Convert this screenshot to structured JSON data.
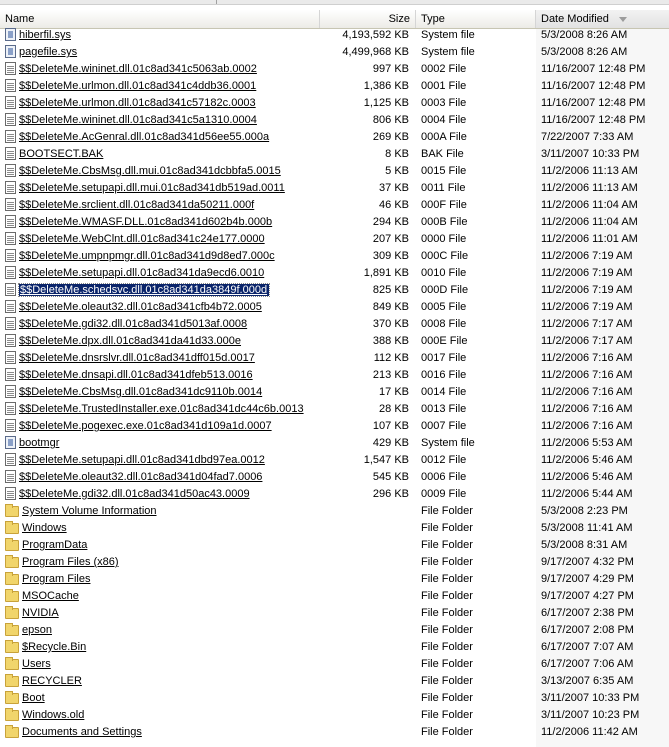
{
  "columns": {
    "name": "Name",
    "size": "Size",
    "type": "Type",
    "date": "Date Modified"
  },
  "selected_row": 15,
  "rows": [
    {
      "name": "hiberfil.sys",
      "size": "4,193,592 KB",
      "type": "System file",
      "date": "5/3/2008 8:26 AM",
      "icon": "sys-file-icon"
    },
    {
      "name": "pagefile.sys",
      "size": "4,499,968 KB",
      "type": "System file",
      "date": "5/3/2008 8:26 AM",
      "icon": "sys-file-icon"
    },
    {
      "name": "$$DeleteMe.wininet.dll.01c8ad341c5063ab.0002",
      "size": "997 KB",
      "type": "0002 File",
      "date": "11/16/2007 12:48 PM",
      "icon": "file-icon"
    },
    {
      "name": "$$DeleteMe.urlmon.dll.01c8ad341c4ddb36.0001",
      "size": "1,386 KB",
      "type": "0001 File",
      "date": "11/16/2007 12:48 PM",
      "icon": "file-icon"
    },
    {
      "name": "$$DeleteMe.urlmon.dll.01c8ad341c57182c.0003",
      "size": "1,125 KB",
      "type": "0003 File",
      "date": "11/16/2007 12:48 PM",
      "icon": "file-icon"
    },
    {
      "name": "$$DeleteMe.wininet.dll.01c8ad341c5a1310.0004",
      "size": "806 KB",
      "type": "0004 File",
      "date": "11/16/2007 12:48 PM",
      "icon": "file-icon"
    },
    {
      "name": "$$DeleteMe.AcGenral.dll.01c8ad341d56ee55.000a",
      "size": "269 KB",
      "type": "000A File",
      "date": "7/22/2007 7:33 AM",
      "icon": "file-icon"
    },
    {
      "name": "BOOTSECT.BAK",
      "size": "8 KB",
      "type": "BAK File",
      "date": "3/11/2007 10:33 PM",
      "icon": "file-icon"
    },
    {
      "name": "$$DeleteMe.CbsMsg.dll.mui.01c8ad341dcbbfa5.0015",
      "size": "5 KB",
      "type": "0015 File",
      "date": "11/2/2006 11:13 AM",
      "icon": "file-icon"
    },
    {
      "name": "$$DeleteMe.setupapi.dll.mui.01c8ad341db519ad.0011",
      "size": "37 KB",
      "type": "0011 File",
      "date": "11/2/2006 11:13 AM",
      "icon": "file-icon"
    },
    {
      "name": "$$DeleteMe.srclient.dll.01c8ad341da50211.000f",
      "size": "46 KB",
      "type": "000F File",
      "date": "11/2/2006 11:04 AM",
      "icon": "file-icon"
    },
    {
      "name": "$$DeleteMe.WMASF.DLL.01c8ad341d602b4b.000b",
      "size": "294 KB",
      "type": "000B File",
      "date": "11/2/2006 11:04 AM",
      "icon": "file-icon"
    },
    {
      "name": "$$DeleteMe.WebClnt.dll.01c8ad341c24e177.0000",
      "size": "207 KB",
      "type": "0000 File",
      "date": "11/2/2006 11:01 AM",
      "icon": "file-icon"
    },
    {
      "name": "$$DeleteMe.umpnpmgr.dll.01c8ad341d9d8ed7.000c",
      "size": "309 KB",
      "type": "000C File",
      "date": "11/2/2006 7:19 AM",
      "icon": "file-icon"
    },
    {
      "name": "$$DeleteMe.setupapi.dll.01c8ad341da9ecd6.0010",
      "size": "1,891 KB",
      "type": "0010 File",
      "date": "11/2/2006 7:19 AM",
      "icon": "file-icon"
    },
    {
      "name": "$$DeleteMe.schedsvc.dll.01c8ad341da3849f.000d",
      "size": "825 KB",
      "type": "000D File",
      "date": "11/2/2006 7:19 AM",
      "icon": "file-icon"
    },
    {
      "name": "$$DeleteMe.oleaut32.dll.01c8ad341cfb4b72.0005",
      "size": "849 KB",
      "type": "0005 File",
      "date": "11/2/2006 7:19 AM",
      "icon": "file-icon"
    },
    {
      "name": "$$DeleteMe.gdi32.dll.01c8ad341d5013af.0008",
      "size": "370 KB",
      "type": "0008 File",
      "date": "11/2/2006 7:17 AM",
      "icon": "file-icon"
    },
    {
      "name": "$$DeleteMe.dpx.dll.01c8ad341da41d33.000e",
      "size": "388 KB",
      "type": "000E File",
      "date": "11/2/2006 7:17 AM",
      "icon": "file-icon"
    },
    {
      "name": "$$DeleteMe.dnsrslvr.dll.01c8ad341dff015d.0017",
      "size": "112 KB",
      "type": "0017 File",
      "date": "11/2/2006 7:16 AM",
      "icon": "file-icon"
    },
    {
      "name": "$$DeleteMe.dnsapi.dll.01c8ad341dfeb513.0016",
      "size": "213 KB",
      "type": "0016 File",
      "date": "11/2/2006 7:16 AM",
      "icon": "file-icon"
    },
    {
      "name": "$$DeleteMe.CbsMsg.dll.01c8ad341dc9110b.0014",
      "size": "17 KB",
      "type": "0014 File",
      "date": "11/2/2006 7:16 AM",
      "icon": "file-icon"
    },
    {
      "name": "$$DeleteMe.TrustedInstaller.exe.01c8ad341dc44c6b.0013",
      "size": "28 KB",
      "type": "0013 File",
      "date": "11/2/2006 7:16 AM",
      "icon": "file-icon"
    },
    {
      "name": "$$DeleteMe.pogexec.exe.01c8ad341d109a1d.0007",
      "size": "107 KB",
      "type": "0007 File",
      "date": "11/2/2006 7:16 AM",
      "icon": "file-icon"
    },
    {
      "name": "bootmgr",
      "size": "429 KB",
      "type": "System file",
      "date": "11/2/2006 5:53 AM",
      "icon": "sys-file-icon"
    },
    {
      "name": "$$DeleteMe.setupapi.dll.01c8ad341dbd97ea.0012",
      "size": "1,547 KB",
      "type": "0012 File",
      "date": "11/2/2006 5:46 AM",
      "icon": "file-icon"
    },
    {
      "name": "$$DeleteMe.oleaut32.dll.01c8ad341d04fad7.0006",
      "size": "545 KB",
      "type": "0006 File",
      "date": "11/2/2006 5:46 AM",
      "icon": "file-icon"
    },
    {
      "name": "$$DeleteMe.gdi32.dll.01c8ad341d50ac43.0009",
      "size": "296 KB",
      "type": "0009 File",
      "date": "11/2/2006 5:44 AM",
      "icon": "file-icon"
    },
    {
      "name": "System Volume Information",
      "size": "",
      "type": "File Folder",
      "date": "5/3/2008 2:23 PM",
      "icon": "folder-icon"
    },
    {
      "name": "Windows",
      "size": "",
      "type": "File Folder",
      "date": "5/3/2008 11:41 AM",
      "icon": "folder-icon"
    },
    {
      "name": "ProgramData",
      "size": "",
      "type": "File Folder",
      "date": "5/3/2008 8:31 AM",
      "icon": "folder-icon"
    },
    {
      "name": "Program Files (x86)",
      "size": "",
      "type": "File Folder",
      "date": "9/17/2007 4:32 PM",
      "icon": "folder-icon"
    },
    {
      "name": "Program Files",
      "size": "",
      "type": "File Folder",
      "date": "9/17/2007 4:29 PM",
      "icon": "folder-icon"
    },
    {
      "name": "MSOCache",
      "size": "",
      "type": "File Folder",
      "date": "9/17/2007 4:27 PM",
      "icon": "folder-icon"
    },
    {
      "name": "NVIDIA",
      "size": "",
      "type": "File Folder",
      "date": "6/17/2007 2:38 PM",
      "icon": "folder-icon"
    },
    {
      "name": "epson",
      "size": "",
      "type": "File Folder",
      "date": "6/17/2007 2:08 PM",
      "icon": "folder-icon"
    },
    {
      "name": "$Recycle.Bin",
      "size": "",
      "type": "File Folder",
      "date": "6/17/2007 7:07 AM",
      "icon": "folder-icon"
    },
    {
      "name": "Users",
      "size": "",
      "type": "File Folder",
      "date": "6/17/2007 7:06 AM",
      "icon": "folder-icon"
    },
    {
      "name": "RECYCLER",
      "size": "",
      "type": "File Folder",
      "date": "3/13/2007 6:35 AM",
      "icon": "folder-icon"
    },
    {
      "name": "Boot",
      "size": "",
      "type": "File Folder",
      "date": "3/11/2007 10:33 PM",
      "icon": "folder-icon"
    },
    {
      "name": "Windows.old",
      "size": "",
      "type": "File Folder",
      "date": "3/11/2007 10:23 PM",
      "icon": "folder-icon"
    },
    {
      "name": "Documents and Settings",
      "size": "",
      "type": "File Folder",
      "date": "11/2/2006 11:42 AM",
      "icon": "folder-icon"
    }
  ]
}
